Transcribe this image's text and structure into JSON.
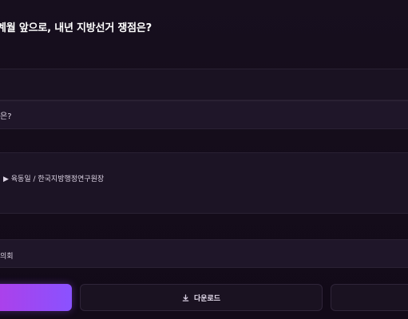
{
  "header": {
    "title": "계월 앞으로, 내년 지방선거 쟁점은?"
  },
  "sections": {
    "question_text": "은?",
    "speaker_text": "▶ 육동일 / 한국지방행정연구원장",
    "program_text": "의회"
  },
  "actions": {
    "download_label": "다운로드",
    "download_icon": "download-icon"
  },
  "colors": {
    "background": "#150d1b",
    "accent_start": "#b23de6",
    "accent_end": "#8a52ff"
  }
}
